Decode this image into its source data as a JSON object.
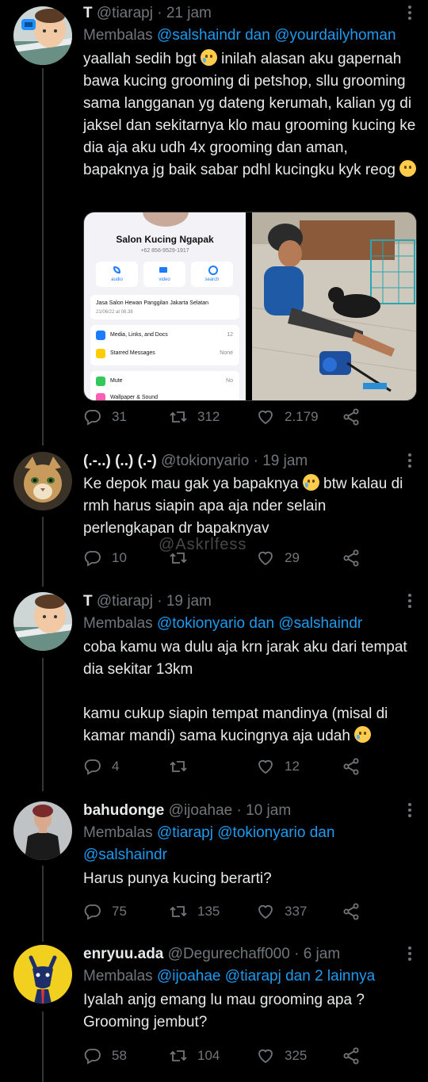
{
  "watermark": "@Askrlfess",
  "tweets": [
    {
      "name": "T",
      "handle": "@tiarapj",
      "sep": "·",
      "time": "21 jam",
      "reply_prefix": "Membalas",
      "reply_links": "@salshaindr dan @yourdailyhoman",
      "text_1": "yaallah sedih bgt",
      "text_2": "inilah alasan aku gapernah bawa kucing grooming di petshop, sllu grooming sama langganan yg dateng kerumah, kalian yg di jaksel dan sekitarnya klo mau grooming kucing ke dia aja aku udh 4x grooming dan aman, bapaknya jg baik sabar pdhl kucingku kyk reog",
      "replies": "31",
      "retweets": "312",
      "likes": "2.179",
      "media": {
        "contact_name": "Salon Kucing Ngapak",
        "phone": "+62 856-9529-1917",
        "btn_audio": "audio",
        "btn_video": "video",
        "btn_search": "search",
        "about": "Jasa Salon Hewan Panggilan Jakarta Selatan",
        "about_date": "21/06/22 at 08.38",
        "row1_label": "Media, Links, and Docs",
        "row1_value": "12",
        "row2_label": "Starred Messages",
        "row2_value": "None",
        "row3_label": "Mute",
        "row3_value": "No",
        "row4_label": "Wallpaper & Sound"
      }
    },
    {
      "name": "(.-..) (..) (.-)",
      "handle": "@tokionyario",
      "sep": "·",
      "time": "19 jam",
      "text_1": "Ke depok mau gak ya bapaknya",
      "text_2": "btw kalau di rmh harus siapin apa aja nder selain perlengkapan dr bapaknyav",
      "replies": "10",
      "retweets": "",
      "likes": "29"
    },
    {
      "name": "T",
      "handle": "@tiarapj",
      "sep": "·",
      "time": "19 jam",
      "reply_prefix": "Membalas",
      "reply_links": "@tokionyario dan @salshaindr",
      "text_1": "coba kamu wa dulu aja krn jarak aku dari tempat dia sekitar 13km\n\nkamu cukup siapin tempat mandinya (misal di kamar mandi) sama kucingnya aja udah",
      "replies": "4",
      "retweets": "",
      "likes": "12"
    },
    {
      "name": "bahudonge",
      "handle": "@ijoahae",
      "sep": "·",
      "time": "10 jam",
      "reply_prefix": "Membalas",
      "reply_links": "@tiarapj @tokionyario dan @salshaindr",
      "text_1": "Harus punya kucing berarti?",
      "replies": "75",
      "retweets": "135",
      "likes": "337"
    },
    {
      "name": "enryuu.ada",
      "handle": "@Degurechaff000",
      "sep": "·",
      "time": "6 jam",
      "reply_prefix": "Membalas",
      "reply_links": "@ijoahae @tiarapj dan 2 lainnya",
      "text_1": "Iyalah anjg emang lu mau grooming apa ? Grooming jembut?",
      "replies": "58",
      "retweets": "104",
      "likes": "325"
    }
  ]
}
